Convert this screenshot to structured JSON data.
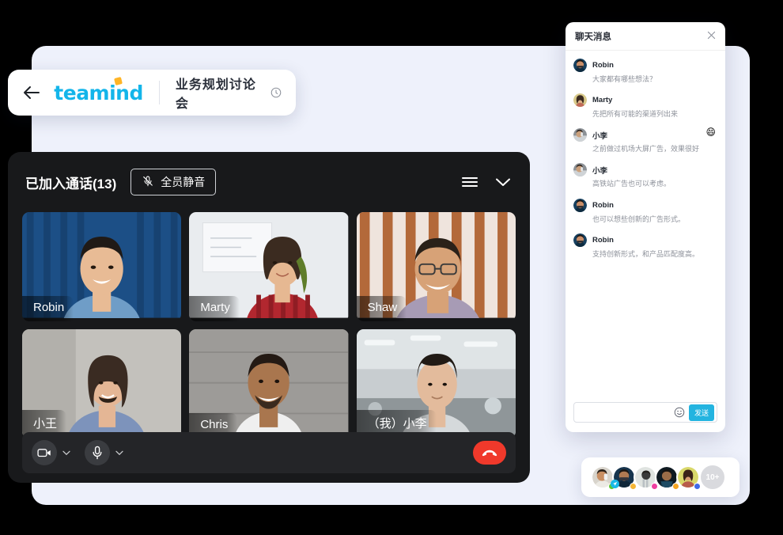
{
  "topbar": {
    "back_icon": "arrow-left-icon",
    "brand": "teamind",
    "meeting_title": "业务规划讨论会",
    "info_icon": "info-circle-icon"
  },
  "call": {
    "joined_label": "已加入通话(13)",
    "mute_all_label": "全员静音",
    "mute_icon": "mic-off-icon",
    "menu_icon": "hamburger-icon",
    "collapse_icon": "chevron-down-icon",
    "tiles": [
      {
        "name": "Robin",
        "bg": "#1c4f86",
        "skin": "#e8bb95",
        "hair": "#201a16",
        "shirt": "#6f9dc7"
      },
      {
        "name": "Marty",
        "bg": "#e9ecef",
        "skin": "#e6b892",
        "hair": "#3b2b20",
        "shirt": "#b2272f"
      },
      {
        "name": "Shaw",
        "bg": "#cfa277",
        "skin": "#d7a277",
        "hair": "#2a2119",
        "shirt": "#a79bb5"
      },
      {
        "name": "小王",
        "bg": "#b9b7b2",
        "skin": "#e4b695",
        "hair": "#3a2b22",
        "shirt": "#7d93bb"
      },
      {
        "name": "Chris",
        "bg": "#a9a7a4",
        "skin": "#a9764e",
        "hair": "#241a14",
        "shirt": "#efefef"
      },
      {
        "name": "（我）小李",
        "bg": "#d3d7d9",
        "skin": "#e3bb9c",
        "hair": "#211a15",
        "shirt": "#d5d9db"
      }
    ],
    "toolbar": {
      "camera_icon": "video-camera-icon",
      "camera_caret": "chevron-down-icon",
      "mic_icon": "microphone-icon",
      "mic_caret": "chevron-down-icon",
      "hangup_icon": "phone-hangup-icon",
      "hangup_color": "#f0392b"
    }
  },
  "chat": {
    "title": "聊天消息",
    "close_icon": "close-icon",
    "messages": [
      {
        "name": "Robin",
        "text": "大家都有哪些想法？",
        "reaction": "",
        "av_bg": "#17405f",
        "skin": "#c98f6a"
      },
      {
        "name": "Marty",
        "text": "先把所有可能的渠道列出来",
        "reaction": "",
        "av_bg": "#d8c98a",
        "skin": "#e0b089"
      },
      {
        "name": "小李",
        "text": "之前做过机场大屏广告，效果很好",
        "reaction": "😄",
        "av_bg": "#8c9196",
        "skin": "#caa07c"
      },
      {
        "name": "小李",
        "text": "高铁站广告也可以考虑。",
        "reaction": "",
        "av_bg": "#8c9196",
        "skin": "#caa07c"
      },
      {
        "name": "Robin",
        "text": "也可以想些创新的广告形式。",
        "reaction": "",
        "av_bg": "#17405f",
        "skin": "#c98f6a"
      },
      {
        "name": "Robin",
        "text": "支持创新形式，和产品匹配度高。",
        "reaction": "",
        "av_bg": "#17405f",
        "skin": "#c98f6a"
      }
    ],
    "input_value": "",
    "input_placeholder": "",
    "emoji_icon": "smiley-icon",
    "send_label": "发送",
    "send_color": "#23b4e0"
  },
  "people": {
    "avatars": [
      {
        "bg": "#d8d4cc",
        "skin": "#c98f63",
        "badge": "#5cc733",
        "mic": false
      },
      {
        "bg": "#16344d",
        "skin": "#b07a52",
        "badge": "#f5b636",
        "mic": true
      },
      {
        "bg": "#dfe3e0",
        "skin": "#3a3a3a",
        "badge": "#ef3fa0",
        "mic": false
      },
      {
        "bg": "#0f1a22",
        "skin": "#9a6c48",
        "badge": "#f5a623",
        "mic": false
      },
      {
        "bg": "#d9d86a",
        "skin": "#d59a72",
        "badge": "#3f6ae8",
        "mic": false
      }
    ],
    "more_label": "10+"
  },
  "colors": {
    "page_bg": "#000000",
    "card_bg": "#eef1fb",
    "panel_bg": "#18191b",
    "brand": "#13b5ea",
    "brand_accent": "#ffb527"
  }
}
